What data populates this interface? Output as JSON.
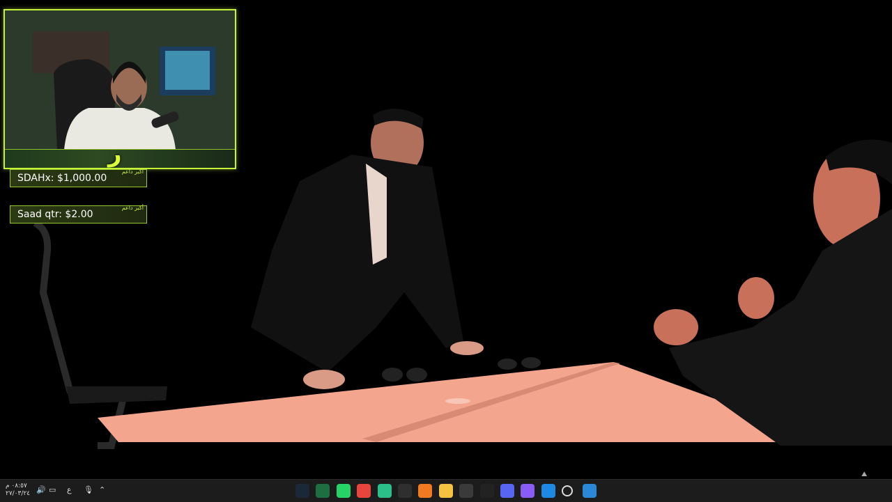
{
  "overlay": {
    "donations": [
      {
        "text": "SDAHx: $1,000.00",
        "tag": "أكبر داعم"
      },
      {
        "text": "Saad qtr: $2.00",
        "tag": "أكبر داعم"
      }
    ],
    "webcam_logo": "ر"
  },
  "taskbar": {
    "clock_time": "٠٨:٥٧ م",
    "clock_date": "٢٧/٠٣/٢٤",
    "lang": "ع",
    "apps": [
      {
        "name": "steam-icon",
        "color": "#1b2838"
      },
      {
        "name": "excel-icon",
        "color": "#1d6f42"
      },
      {
        "name": "whatsapp-icon",
        "color": "#25d366"
      },
      {
        "name": "chrome-icon",
        "color": "#e8453c"
      },
      {
        "name": "app-green-icon",
        "color": "#2bbf8a"
      },
      {
        "name": "discord-alt-icon",
        "color": "#2f2f2f"
      },
      {
        "name": "app-orange-icon",
        "color": "#f07a22"
      },
      {
        "name": "file-explorer-icon",
        "color": "#f5c242"
      },
      {
        "name": "obs-icon",
        "color": "#3a3a3a"
      },
      {
        "name": "g-app-icon",
        "color": "#222222"
      },
      {
        "name": "discord-icon",
        "color": "#5865f2"
      },
      {
        "name": "copilot-icon",
        "color": "#8a5cf6"
      },
      {
        "name": "edge-icon",
        "color": "#1e88e5"
      },
      {
        "name": "search-icon",
        "color": "#1c1c1c"
      },
      {
        "name": "windows-start-icon",
        "color": "#2b88d8"
      }
    ]
  }
}
